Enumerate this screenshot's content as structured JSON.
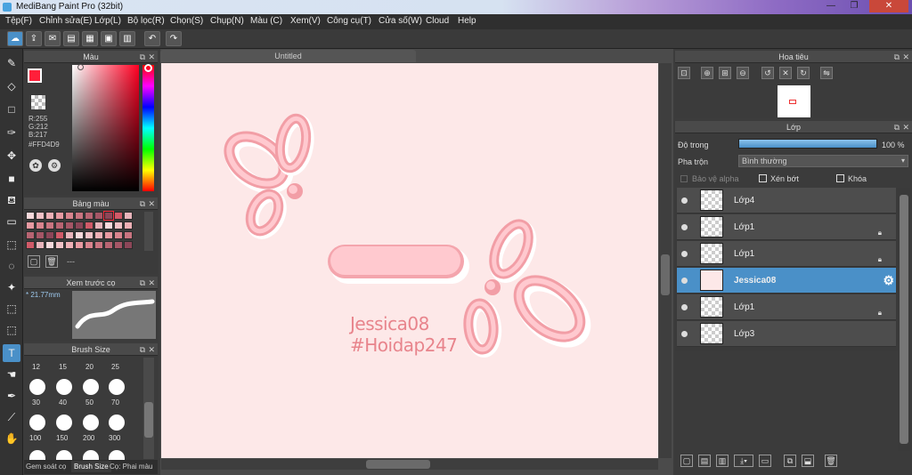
{
  "window": {
    "title": "MediBang Paint Pro (32bit)",
    "minimize": "—",
    "maximize": "❐",
    "close": "✕"
  },
  "menu": [
    "Tệp(F)",
    "Chỉnh sửa(E)",
    "Lớp(L)",
    "Bộ lọc(R)",
    "Chọn(S)",
    "Chụp(N)",
    "Màu (C)",
    "Xem(V)",
    "Công cụ(T)",
    "Cửa số(W)",
    "Cloud",
    "Help"
  ],
  "canvas": {
    "tab_title": "Untitled",
    "background_color": "#fde8e8",
    "watermark_line1": "Jessica08",
    "watermark_line2": "#Hoidap247"
  },
  "color_panel": {
    "title": "Màu",
    "r": "R:255",
    "g": "G:212",
    "b": "B:217",
    "hex": "#FFD4D9",
    "primary_color": "#ff1f3a",
    "secondary_color": "#ffffff"
  },
  "swatch_panel": {
    "title": "Bảng màu",
    "footer_text": "---"
  },
  "preview_panel": {
    "title": "Xem trước cọ",
    "size": "* 21.77mm"
  },
  "brush_panel": {
    "title": "Brush Size",
    "top_sizes": [
      "12",
      "15",
      "20",
      "25"
    ],
    "rows": [
      [
        "30",
        "40",
        "50",
        "70"
      ],
      [
        "100",
        "150",
        "200",
        "300"
      ]
    ],
    "tabs": [
      "Gem soát cọ",
      "Brush Size",
      "Cọ: Phai màu"
    ]
  },
  "nav_panel": {
    "title": "Hoa tiêu"
  },
  "layer_panel": {
    "title": "Lớp",
    "opacity_label": "Độ trong",
    "opacity_value": "100 %",
    "opacity_fraction": 1.0,
    "blend_label": "Pha trộn",
    "blend_value": "Bình thường",
    "protect_alpha": "Bảo vệ alpha",
    "clipping": "Xén bớt",
    "lock": "Khóa",
    "layers": [
      {
        "name": "Lớp4",
        "selected": false,
        "locked": false
      },
      {
        "name": "Lớp1",
        "selected": false,
        "locked": true
      },
      {
        "name": "Lớp1",
        "selected": false,
        "locked": true
      },
      {
        "name": "Jessica08",
        "selected": true,
        "locked": false
      },
      {
        "name": "Lớp1",
        "selected": false,
        "locked": true
      },
      {
        "name": "Lớp3",
        "selected": false,
        "locked": false
      }
    ]
  },
  "accent_color": "#4a90c8"
}
